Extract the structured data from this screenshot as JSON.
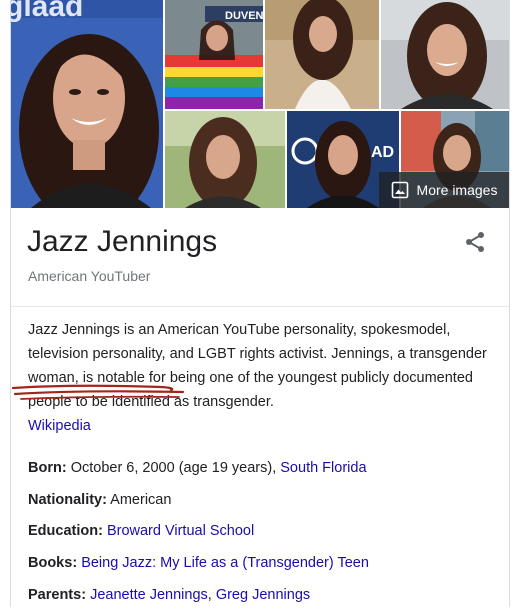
{
  "photos": {
    "watermark_text": "glaad",
    "banner_text": "DUVEN",
    "sign_text": "AD",
    "more_images": {
      "label": "More images",
      "icon": "image-icon"
    }
  },
  "entity": {
    "title": "Jazz Jennings",
    "subtitle": "American YouTuber",
    "share_icon": "share-icon"
  },
  "description": {
    "part1": "Jazz Jennings is an American YouTube personality, spokesmodel, television personality, and LGBT rights activist. Jennings, a ",
    "highlight": "transgender woman",
    "part2": ", is notable for being one of the youngest publicly documented people to be identified as transgender.",
    "source": "Wikipedia"
  },
  "facts": [
    {
      "label": "Born:",
      "text": " October 6, 2000 (age 19 years), ",
      "links": [
        "South Florida"
      ]
    },
    {
      "label": "Nationality:",
      "text": " American",
      "links": []
    },
    {
      "label": "Education:",
      "text": " ",
      "links": [
        "Broward Virtual School"
      ]
    },
    {
      "label": "Books:",
      "text": " ",
      "links": [
        "Being Jazz: My Life as a (Transgender) Teen"
      ]
    },
    {
      "label": "Parents:",
      "text": " ",
      "links": [
        "Jeanette Jennings",
        "Greg Jennings"
      ]
    }
  ],
  "colors": {
    "link": "#1a0dab",
    "annotation": "#a0271c",
    "text": "#202124",
    "muted": "#70757a"
  }
}
